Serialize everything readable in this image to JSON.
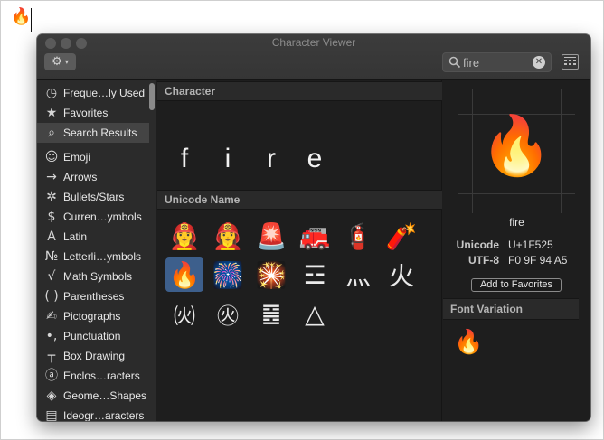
{
  "document": {
    "typed_char": "🔥"
  },
  "window": {
    "title": "Character Viewer",
    "action_icon": "gear-icon",
    "search": {
      "value": "fire",
      "placeholder": "Search"
    }
  },
  "sidebar": {
    "items": [
      {
        "icon": "clock-icon",
        "glyph": "◷",
        "label": "Freque…ly Used",
        "selected": false
      },
      {
        "icon": "star-icon",
        "glyph": "★",
        "label": "Favorites",
        "selected": false
      },
      {
        "icon": "search-icon",
        "glyph": "⌕",
        "label": "Search Results",
        "selected": true
      },
      {
        "icon": "smiley-icon",
        "glyph": "☺",
        "label": "Emoji",
        "selected": false
      },
      {
        "icon": "arrow-icon",
        "glyph": "→",
        "label": "Arrows",
        "selected": false
      },
      {
        "icon": "asterisk-icon",
        "glyph": "✲",
        "label": "Bullets/Stars",
        "selected": false
      },
      {
        "icon": "dollar-icon",
        "glyph": "$",
        "label": "Curren…ymbols",
        "selected": false
      },
      {
        "icon": "latin-a-icon",
        "glyph": "A",
        "label": "Latin",
        "selected": false
      },
      {
        "icon": "numero-icon",
        "glyph": "№",
        "label": "Letterli…ymbols",
        "selected": false
      },
      {
        "icon": "square-root-icon",
        "glyph": "√",
        "label": "Math Symbols",
        "selected": false
      },
      {
        "icon": "parentheses-icon",
        "glyph": "( )",
        "label": "Parentheses",
        "selected": false
      },
      {
        "icon": "pictograph-icon",
        "glyph": "✍",
        "label": "Pictographs",
        "selected": false
      },
      {
        "icon": "punctuation-icon",
        "glyph": "•,",
        "label": "Punctuation",
        "selected": false
      },
      {
        "icon": "box-drawing-icon",
        "glyph": "┬",
        "label": "Box Drawing",
        "selected": false
      },
      {
        "icon": "enclosed-a-icon",
        "glyph": "ⓐ",
        "label": "Enclos…racters",
        "selected": false
      },
      {
        "icon": "diamond-icon",
        "glyph": "◈",
        "label": "Geome…Shapes",
        "selected": false
      },
      {
        "icon": "ideograph-icon",
        "glyph": "▤",
        "label": "Ideogr…aracters",
        "selected": false
      }
    ]
  },
  "middle": {
    "character_header": "Character",
    "letters": [
      "f",
      "i",
      "r",
      "e"
    ],
    "unicode_header": "Unicode Name",
    "glyphs": [
      {
        "name": "woman-firefighter-icon",
        "char": "👩‍🚒"
      },
      {
        "name": "woman-firefighter-2-icon",
        "char": "👩‍🚒"
      },
      {
        "name": "police-light-icon",
        "char": "🚨"
      },
      {
        "name": "fire-engine-icon",
        "char": "🚒"
      },
      {
        "name": "fire-extinguisher-icon",
        "char": "🧯"
      },
      {
        "name": "firecracker-icon",
        "char": "🧨"
      },
      {
        "name": "fire-icon",
        "char": "🔥",
        "selected": true
      },
      {
        "name": "fireworks-icon",
        "char": "🎆"
      },
      {
        "name": "sparkler-icon",
        "char": "🎇"
      },
      {
        "name": "trigram-fire-icon",
        "char": "☲"
      },
      {
        "name": "fire-radical-icon",
        "char": "灬"
      },
      {
        "name": "fire-ideograph-icon",
        "char": "火"
      },
      {
        "name": "parenthesized-fire-icon",
        "char": "㈫"
      },
      {
        "name": "circled-fire-icon",
        "char": "㊋"
      },
      {
        "name": "hexagram-fire-icon",
        "char": "䷝"
      },
      {
        "name": "alchemical-fire-icon",
        "char": "△"
      }
    ]
  },
  "details": {
    "preview_char": "🔥",
    "name": "fire",
    "unicode_label": "Unicode",
    "unicode_value": "U+1F525",
    "utf8_label": "UTF-8",
    "utf8_value": "F0 9F 94 A5",
    "add_favorites_label": "Add to Favorites",
    "font_variation_header": "Font Variation",
    "variation_char": "🔥"
  },
  "colors": {
    "window_bg": "#1e1e1e",
    "sidebar_bg": "#2b2b2b",
    "selection": "#3d5f8c"
  }
}
